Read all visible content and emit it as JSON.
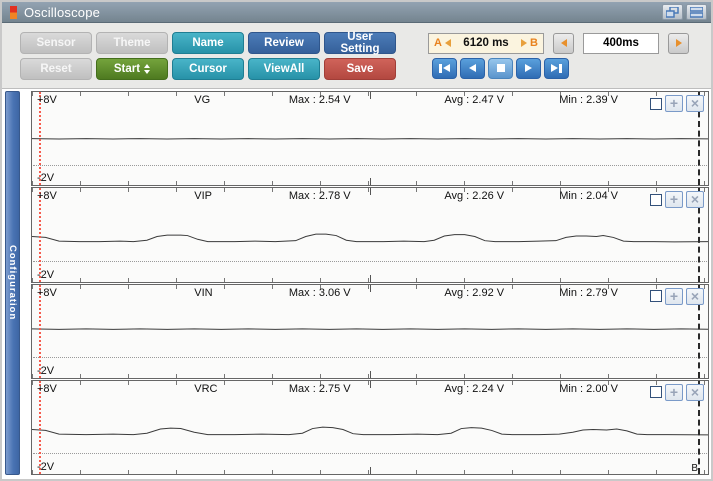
{
  "window": {
    "title": "Oscilloscope"
  },
  "toolbar": {
    "rows": [
      [
        {
          "label": "Sensor",
          "style": "disabled"
        },
        {
          "label": "Theme",
          "style": "disabled"
        },
        {
          "label": "Name",
          "style": "teal"
        },
        {
          "label": "Review",
          "style": "blue"
        },
        {
          "label": "User Setting",
          "style": "blue"
        }
      ],
      [
        {
          "label": "Reset",
          "style": "disabled"
        },
        {
          "label": "Start",
          "style": "green",
          "spinner": true
        },
        {
          "label": "Cursor",
          "style": "teal"
        },
        {
          "label": "ViewAll",
          "style": "teal"
        },
        {
          "label": "Save",
          "style": "red"
        }
      ]
    ]
  },
  "timebar": {
    "a_label": "A",
    "b_label": "B",
    "range_value": "6120 ms",
    "step_value": "400ms"
  },
  "playback_buttons": [
    "skip-to-start",
    "step-back",
    "stop",
    "play",
    "skip-to-end"
  ],
  "sidebar": {
    "label": "Configuration"
  },
  "channels": [
    {
      "name": "VG",
      "max": "Max : 2.54 V",
      "avg": "Avg : 2.47 V",
      "min": "Min : 2.39 V",
      "top_scale": "+8V",
      "bottom_scale": "-2V",
      "corner_label": "",
      "wave": [
        [
          0,
          50
        ],
        [
          4,
          50.4
        ],
        [
          8,
          50
        ],
        [
          12,
          50.4
        ],
        [
          16,
          50
        ],
        [
          20,
          50.4
        ],
        [
          24,
          50
        ],
        [
          28,
          50.4
        ],
        [
          32,
          50
        ],
        [
          36,
          50.4
        ],
        [
          40,
          50
        ],
        [
          44,
          50.4
        ],
        [
          48,
          50
        ],
        [
          52,
          50.4
        ],
        [
          56,
          50
        ],
        [
          60,
          50.4
        ],
        [
          64,
          50
        ],
        [
          68,
          50.4
        ],
        [
          72,
          50
        ],
        [
          76,
          50.4
        ],
        [
          80,
          50
        ],
        [
          84,
          50.4
        ],
        [
          88,
          50
        ],
        [
          92,
          50.4
        ],
        [
          96,
          50
        ],
        [
          100,
          50.3
        ]
      ]
    },
    {
      "name": "VIP",
      "max": "Max : 2.78 V",
      "avg": "Avg : 2.26 V",
      "min": "Min : 2.04 V",
      "top_scale": "+8V",
      "bottom_scale": "-2V",
      "corner_label": "",
      "wave": [
        [
          0,
          52
        ],
        [
          2,
          53
        ],
        [
          4,
          57
        ],
        [
          7,
          57.5
        ],
        [
          10,
          57.5
        ],
        [
          13,
          57
        ],
        [
          15,
          57.5
        ],
        [
          17,
          56
        ],
        [
          18.5,
          52
        ],
        [
          20,
          50.5
        ],
        [
          22,
          50.5
        ],
        [
          23,
          51
        ],
        [
          24.5,
          55
        ],
        [
          26,
          57.5
        ],
        [
          30,
          57.5
        ],
        [
          33,
          57
        ],
        [
          36,
          57.5
        ],
        [
          39,
          56.5
        ],
        [
          40.5,
          52
        ],
        [
          42,
          49.5
        ],
        [
          43.5,
          49.5
        ],
        [
          45,
          51
        ],
        [
          46.5,
          56
        ],
        [
          48,
          57.5
        ],
        [
          52,
          57.5
        ],
        [
          55,
          57
        ],
        [
          58,
          57.5
        ],
        [
          59.5,
          56
        ],
        [
          61,
          51.5
        ],
        [
          62.5,
          50
        ],
        [
          64,
          50
        ],
        [
          65.5,
          52
        ],
        [
          67,
          56.5
        ],
        [
          68.5,
          57.5
        ],
        [
          72,
          57.5
        ],
        [
          75,
          57
        ],
        [
          77.5,
          56.5
        ],
        [
          79,
          53
        ],
        [
          80.5,
          51.5
        ],
        [
          82,
          51.5
        ],
        [
          83.5,
          52
        ],
        [
          84.5,
          51
        ],
        [
          86,
          53
        ],
        [
          87.5,
          57
        ],
        [
          89,
          57.5
        ],
        [
          92,
          57.5
        ],
        [
          95,
          57.8
        ],
        [
          100,
          57.5
        ]
      ]
    },
    {
      "name": "VIN",
      "max": "Max : 3.06 V",
      "avg": "Avg : 2.92 V",
      "min": "Min : 2.79 V",
      "top_scale": "+8V",
      "bottom_scale": "-2V",
      "corner_label": "",
      "wave": [
        [
          0,
          47
        ],
        [
          4,
          47.6
        ],
        [
          8,
          47
        ],
        [
          12,
          47.6
        ],
        [
          16,
          47
        ],
        [
          20,
          47.6
        ],
        [
          24,
          47
        ],
        [
          28,
          47.6
        ],
        [
          32,
          47
        ],
        [
          36,
          47.6
        ],
        [
          40,
          47
        ],
        [
          44,
          47.6
        ],
        [
          48,
          47
        ],
        [
          52,
          47.6
        ],
        [
          56,
          47
        ],
        [
          60,
          47.6
        ],
        [
          64,
          47
        ],
        [
          68,
          47.6
        ],
        [
          72,
          47
        ],
        [
          76,
          47.6
        ],
        [
          80,
          47
        ],
        [
          84,
          47.6
        ],
        [
          88,
          47
        ],
        [
          92,
          47.6
        ],
        [
          96,
          47
        ],
        [
          100,
          47.4
        ]
      ]
    },
    {
      "name": "VRC",
      "max": "Max : 2.75 V",
      "avg": "Avg : 2.24 V",
      "min": "Min : 2.00 V",
      "top_scale": "+8V",
      "bottom_scale": "-2V",
      "corner_label": "B",
      "wave": [
        [
          0,
          52
        ],
        [
          2,
          53
        ],
        [
          4,
          57
        ],
        [
          8,
          57.5
        ],
        [
          12,
          57
        ],
        [
          15,
          57.5
        ],
        [
          17,
          56
        ],
        [
          19,
          51.5
        ],
        [
          20.5,
          50.5
        ],
        [
          22,
          51
        ],
        [
          24,
          55
        ],
        [
          26,
          57.5
        ],
        [
          30,
          57.5
        ],
        [
          34,
          57
        ],
        [
          38,
          57.5
        ],
        [
          40,
          56
        ],
        [
          41.5,
          51
        ],
        [
          43,
          49.5
        ],
        [
          44.5,
          50
        ],
        [
          46,
          52
        ],
        [
          47.5,
          56.5
        ],
        [
          49,
          57.5
        ],
        [
          53,
          57.5
        ],
        [
          57,
          57
        ],
        [
          60,
          57.5
        ],
        [
          62,
          56
        ],
        [
          63.5,
          51
        ],
        [
          65,
          50
        ],
        [
          66.5,
          50.5
        ],
        [
          68,
          53
        ],
        [
          69.5,
          57
        ],
        [
          71,
          57.5
        ],
        [
          75,
          57.5
        ],
        [
          78,
          57
        ],
        [
          80,
          55
        ],
        [
          81.5,
          52.5
        ],
        [
          83,
          52
        ],
        [
          85,
          52.5
        ],
        [
          86.5,
          51.5
        ],
        [
          88,
          53.5
        ],
        [
          89.5,
          57
        ],
        [
          91,
          57.5
        ],
        [
          94,
          57.5
        ],
        [
          100,
          57.8
        ]
      ]
    }
  ],
  "icons": {
    "app_icon": "red-orange-bars",
    "window_controls": [
      "restore-window",
      "minimize-window"
    ],
    "ab_arrows": [
      "left-triangle",
      "right-triangle"
    ],
    "step_arrows": [
      "left-triangle",
      "right-triangle"
    ],
    "start_spinner": "up-down-triangles",
    "playback": [
      "skip-to-start",
      "step-back",
      "stop",
      "play",
      "skip-to-end"
    ],
    "channel_buttons": [
      "plus",
      "close"
    ]
  },
  "colors": {
    "teal": "#2f9fb4",
    "blue": "#3c6ca8",
    "green": "#568a28",
    "red": "#c05149",
    "disabled": "#c6c6c6",
    "accent_orange": "#e8821e",
    "cursor_a": "#f65c4e",
    "cursor_b": "#2a2a2a",
    "titlebar": "#84949f",
    "sidebar_blue": "#4a74b4",
    "ab_display_bg": "#fbf4df"
  }
}
